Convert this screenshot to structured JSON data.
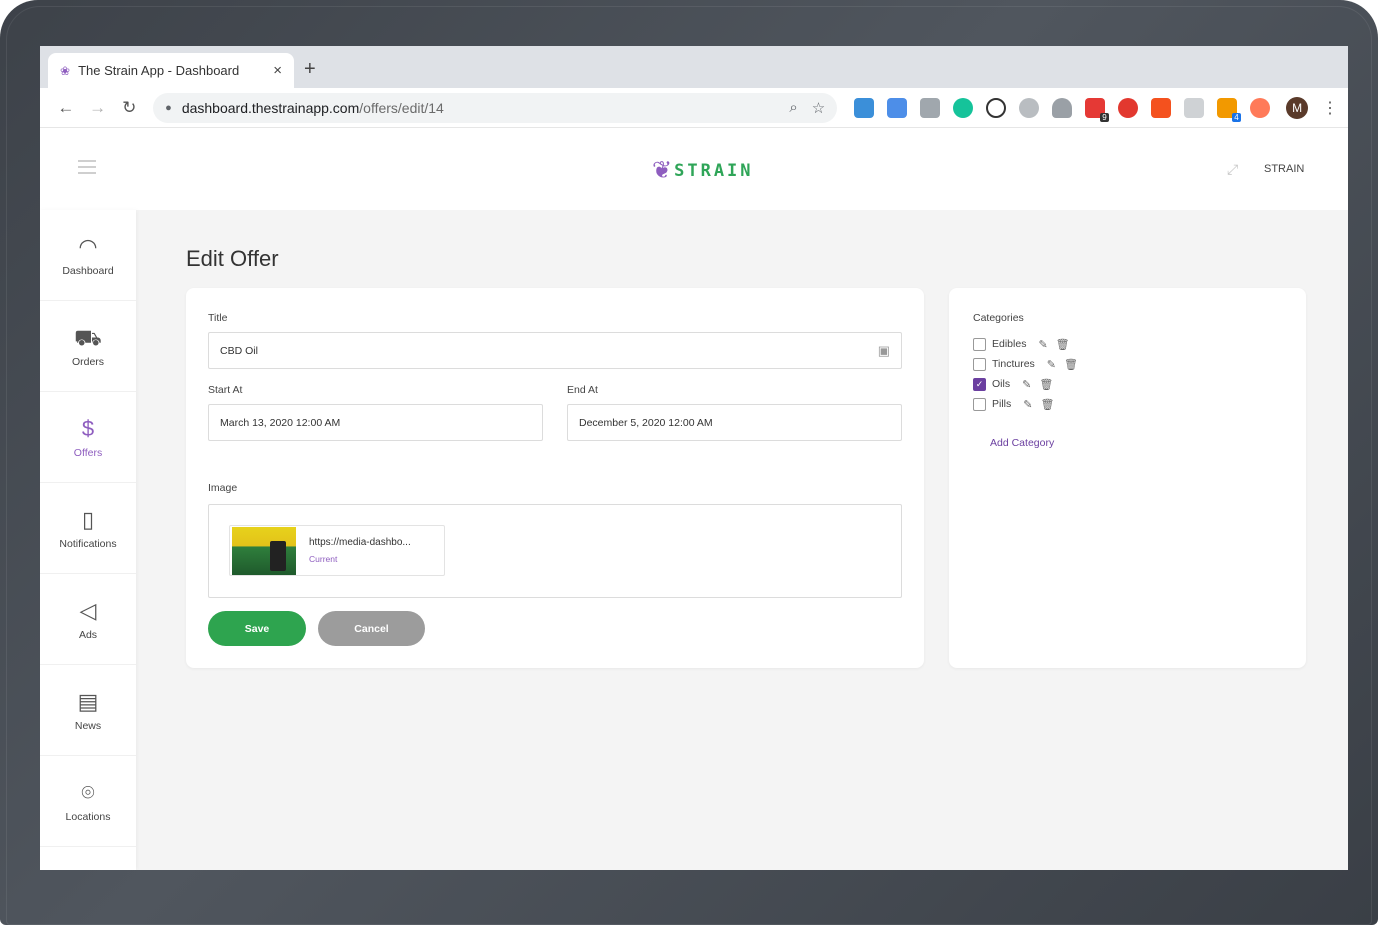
{
  "browser": {
    "tab_title": "The Strain App - Dashboard",
    "tab_close": "×",
    "new_tab": "+",
    "url_host": "dashboard.thestrainapp.com",
    "url_path": "/offers/edit/14",
    "profile_initial": "M",
    "extension_badges": [
      "9",
      "4"
    ]
  },
  "header": {
    "brand": "STRAIN",
    "user": "STRAIN"
  },
  "sidebar": {
    "items": [
      {
        "label": "Dashboard",
        "icon": "gauge-icon"
      },
      {
        "label": "Orders",
        "icon": "cart-icon"
      },
      {
        "label": "Offers",
        "icon": "price-tag-icon",
        "active": true
      },
      {
        "label": "Notifications",
        "icon": "notification-icon"
      },
      {
        "label": "Ads",
        "icon": "megaphone-icon"
      },
      {
        "label": "News",
        "icon": "newspaper-icon"
      },
      {
        "label": "Locations",
        "icon": "location-pin-icon"
      }
    ]
  },
  "page": {
    "title": "Edit Offer"
  },
  "form": {
    "title_label": "Title",
    "title_value": "CBD Oil",
    "start_label": "Start At",
    "start_value": "March 13, 2020 12:00 AM",
    "end_label": "End At",
    "end_value": "December 5, 2020 12:00 AM",
    "image_label": "Image",
    "image_url": "https://media-dashbo...",
    "image_status": "Current",
    "save": "Save",
    "cancel": "Cancel"
  },
  "categories": {
    "title": "Categories",
    "items": [
      {
        "name": "Edibles",
        "checked": false
      },
      {
        "name": "Tinctures",
        "checked": false
      },
      {
        "name": "Oils",
        "checked": true
      },
      {
        "name": "Pills",
        "checked": false
      }
    ],
    "add_label": "Add Category"
  },
  "colors": {
    "accent": "#8e5dbf",
    "brand_green": "#2fa558",
    "save_button": "#2ea44f",
    "cancel_button": "#9c9c9c"
  }
}
